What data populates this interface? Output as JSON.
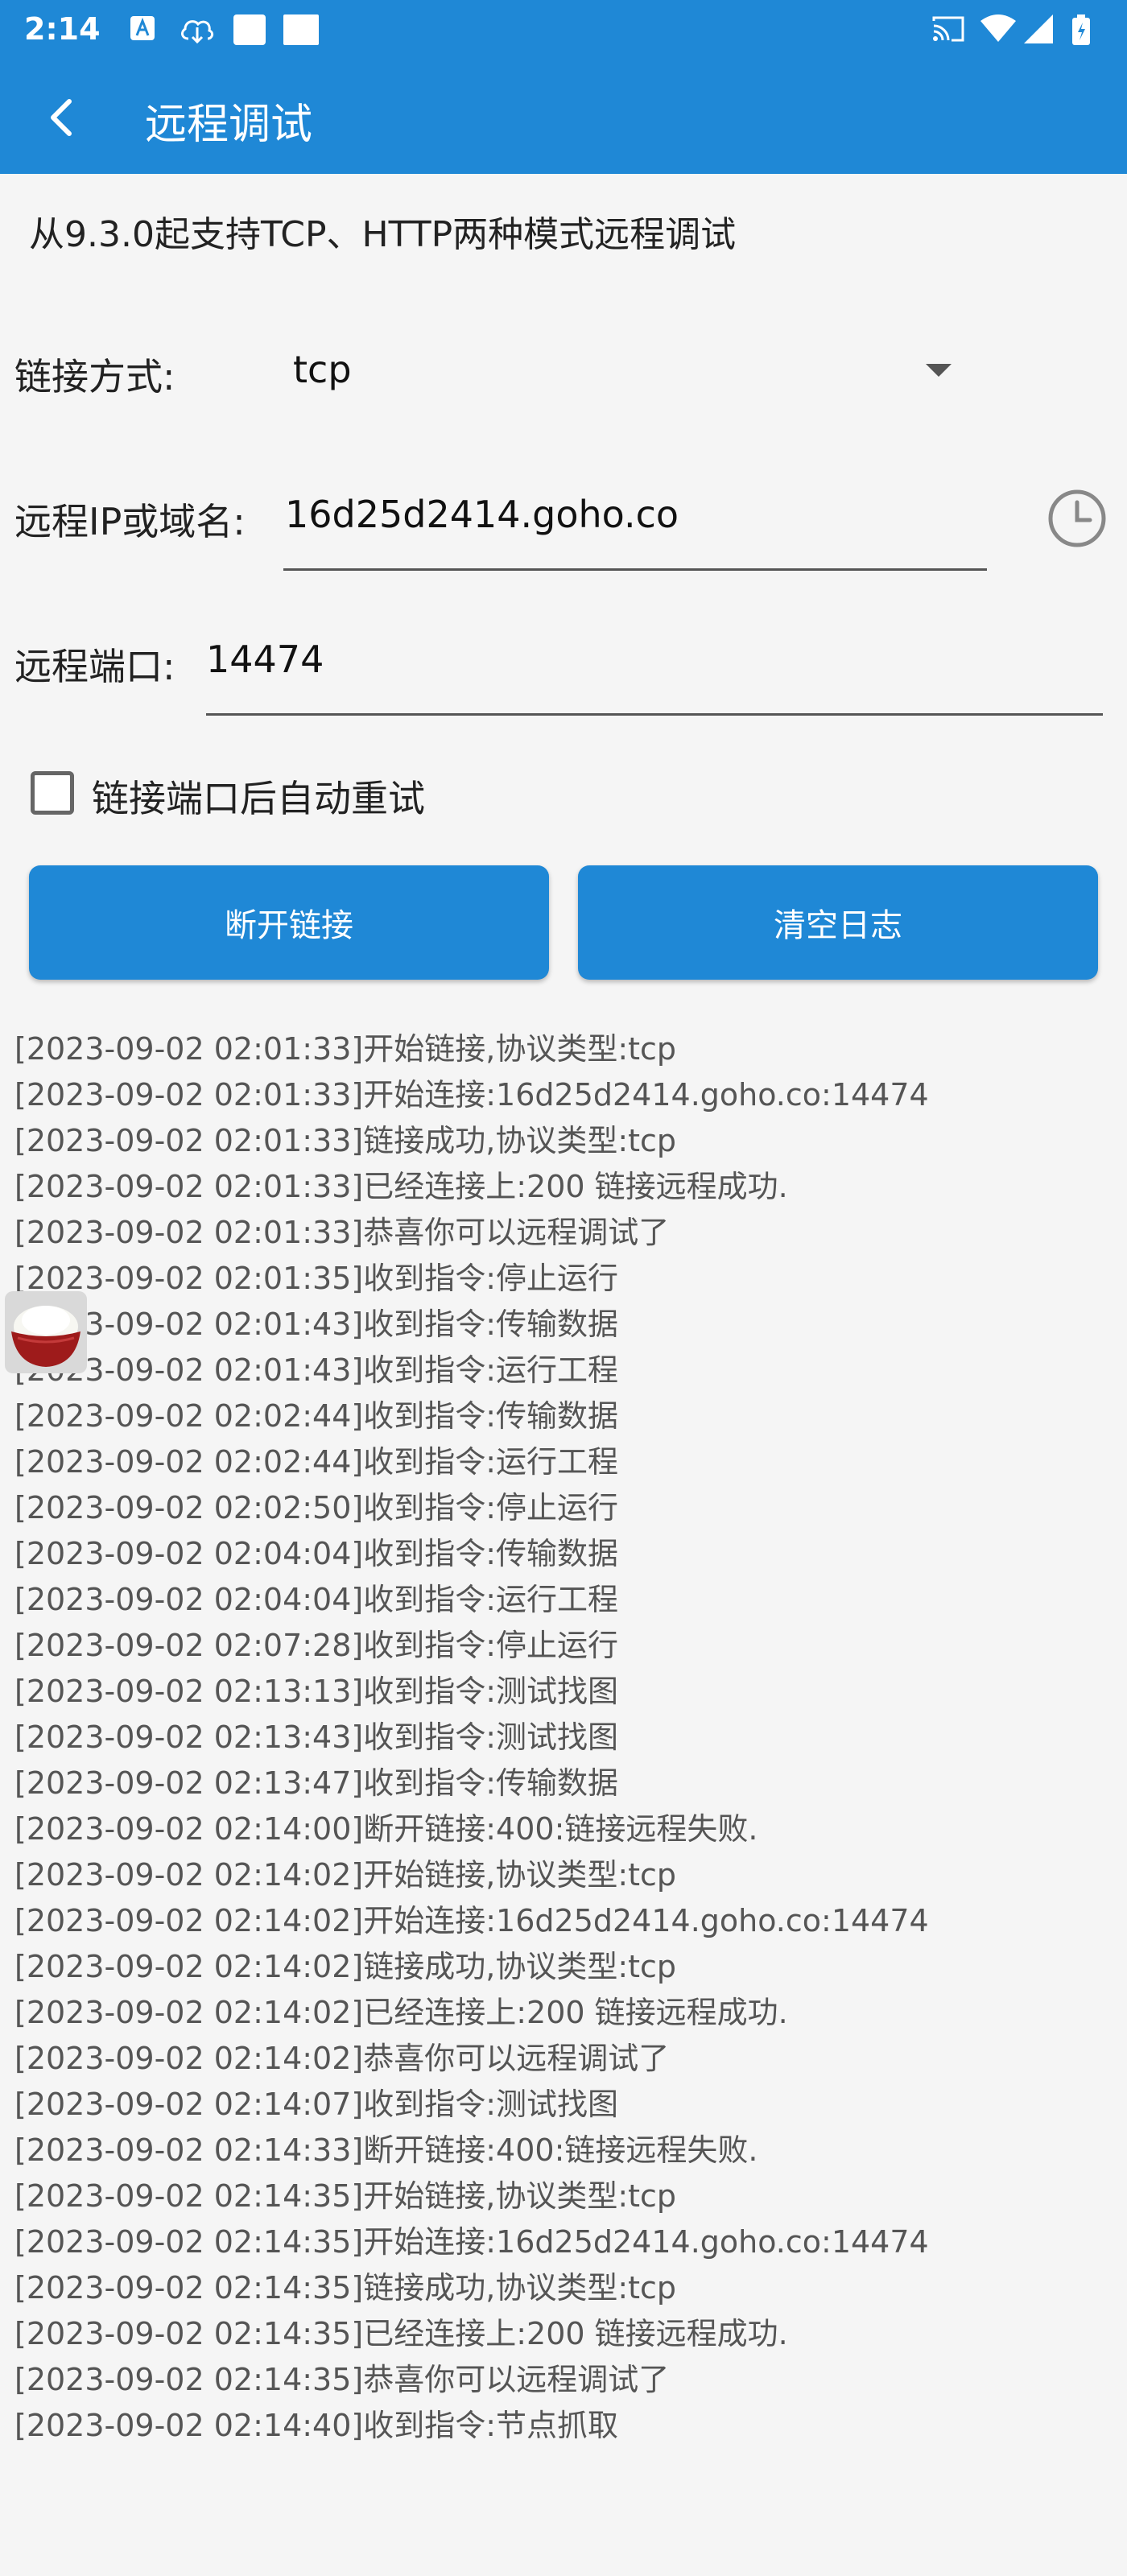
{
  "status_bar": {
    "time": "2:14",
    "icons": [
      "text-a-icon",
      "cloud-download-icon",
      "square-icon",
      "square-icon",
      "cast-icon",
      "wifi-icon",
      "signal-icon",
      "battery-icon"
    ]
  },
  "app_bar": {
    "title": "远程调试",
    "back_icon": "arrow-back-icon"
  },
  "intro_text": "从9.3.0起支持TCP、HTTP两种模式远程调试",
  "form": {
    "link_mode_label": "链接方式:",
    "link_mode_value": "tcp",
    "remote_host_label": "远程IP或域名:",
    "remote_host_value": "16d25d2414.goho.co",
    "remote_port_label": "远程端口:",
    "remote_port_value": "14474",
    "auto_retry_label": "链接端口后自动重试",
    "auto_retry_checked": false
  },
  "buttons": {
    "disconnect": "断开链接",
    "clear_log": "清空日志"
  },
  "colors": {
    "accent": "#1f88d6"
  },
  "log": [
    "[2023-09-02 02:01:33]开始链接,协议类型:tcp",
    "[2023-09-02 02:01:33]开始连接:16d25d2414.goho.co:14474",
    "[2023-09-02 02:01:33]链接成功,协议类型:tcp",
    "[2023-09-02 02:01:33]已经连接上:200 链接远程成功.",
    "[2023-09-02 02:01:33]恭喜你可以远程调试了",
    "[2023-09-02 02:01:35]收到指令:停止运行",
    "[2023-09-02 02:01:43]收到指令:传输数据",
    "[2023-09-02 02:01:43]收到指令:运行工程",
    "[2023-09-02 02:02:44]收到指令:传输数据",
    "[2023-09-02 02:02:44]收到指令:运行工程",
    "[2023-09-02 02:02:50]收到指令:停止运行",
    "[2023-09-02 02:04:04]收到指令:传输数据",
    "[2023-09-02 02:04:04]收到指令:运行工程",
    "[2023-09-02 02:07:28]收到指令:停止运行",
    "[2023-09-02 02:13:13]收到指令:测试找图",
    "[2023-09-02 02:13:43]收到指令:测试找图",
    "[2023-09-02 02:13:47]收到指令:传输数据",
    "[2023-09-02 02:14:00]断开链接:400:链接远程失败.",
    "[2023-09-02 02:14:02]开始链接,协议类型:tcp",
    "[2023-09-02 02:14:02]开始连接:16d25d2414.goho.co:14474",
    "[2023-09-02 02:14:02]链接成功,协议类型:tcp",
    "[2023-09-02 02:14:02]已经连接上:200 链接远程成功.",
    "[2023-09-02 02:14:02]恭喜你可以远程调试了",
    "[2023-09-02 02:14:07]收到指令:测试找图",
    "[2023-09-02 02:14:33]断开链接:400:链接远程失败.",
    "[2023-09-02 02:14:35]开始链接,协议类型:tcp",
    "[2023-09-02 02:14:35]开始连接:16d25d2414.goho.co:14474",
    "[2023-09-02 02:14:35]链接成功,协议类型:tcp",
    "[2023-09-02 02:14:35]已经连接上:200 链接远程成功.",
    "[2023-09-02 02:14:35]恭喜你可以远程调试了",
    "[2023-09-02 02:14:40]收到指令:节点抓取"
  ]
}
